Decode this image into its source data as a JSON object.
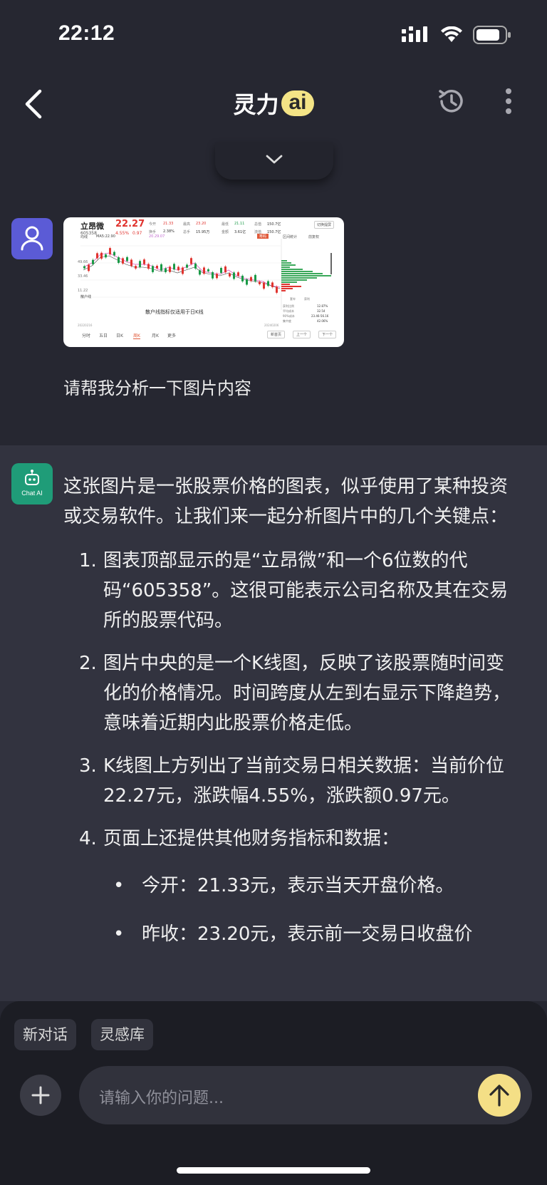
{
  "status_bar": {
    "time": "22:12"
  },
  "header": {
    "title": "灵力",
    "badge": "ai"
  },
  "user_message": {
    "text": "请帮我分析一下图片内容",
    "image": {
      "stock_name": "立昂微",
      "stock_code": "605358",
      "price": "22.27",
      "change_pct": "4.55%",
      "change_amt": "0.97",
      "quote_labels": [
        "今开",
        "换手",
        "最高",
        "总手",
        "最低",
        "金额",
        "总值",
        "流值"
      ],
      "quote_values": [
        "21.33",
        "2.38%",
        "23.20",
        "15.95万",
        "21.11",
        "3.61亿",
        "150.7亿",
        "150.7亿"
      ],
      "switch_btn": "切换提屏",
      "indicator": "均线",
      "ma_text": "MA5:22.90",
      "ma_text2": "20.29.07",
      "side_tabs": [
        "筹码",
        "区间统计",
        "前复权"
      ],
      "y_labels": [
        "",
        "49.66",
        "33.46",
        "11.22"
      ],
      "dots_label": "散户线",
      "notice": "散户线指标仅适用于日K线",
      "date_start": "20220216",
      "date_end": "20240206",
      "bottom_tabs": [
        "分时",
        "五日",
        "日K",
        "周K",
        "月K",
        "更多"
      ],
      "active_tab": "周K",
      "nav_buttons": [
        "新首页",
        "上一个",
        "下一个"
      ],
      "chip_stats_labels": [
        "获利比例",
        "平均成本",
        "90%成本",
        "集中度"
      ],
      "chip_stats_values": [
        "12.87%",
        "32.54",
        "23.46-56.16",
        "42.06%"
      ],
      "legend": [
        "套牢",
        "获利"
      ]
    }
  },
  "ai_message": {
    "avatar_label": "Chat AI",
    "intro": "这张图片是一张股票价格的图表，似乎使用了某种投资或交易软件。让我们来一起分析图片中的几个关键点：",
    "items": [
      {
        "num": "1.",
        "text": "图表顶部显示的是“立昂微”和一个6位数的代码“605358”。这很可能表示公司名称及其在交易所的股票代码。"
      },
      {
        "num": "2.",
        "text": "图片中央的是一个K线图，反映了该股票随时间变化的价格情况。时间跨度从左到右显示下降趋势，意味着近期内此股票价格走低。"
      },
      {
        "num": "3.",
        "text": "K线图上方列出了当前交易日相关数据：当前价位22.27元，涨跌幅4.55%，涨跌额0.97元。"
      },
      {
        "num": "4.",
        "text": "页面上还提供其他财务指标和数据："
      }
    ],
    "bullets": [
      {
        "dot": "•",
        "text": "今开：21.33元，表示当天开盘价格。"
      },
      {
        "dot": "•",
        "text": "昨收：23.20元，表示前一交易日收盘价"
      }
    ]
  },
  "bottom": {
    "chips": [
      "新对话",
      "灵感库"
    ],
    "input_placeholder": "请输入你的问题..."
  },
  "colors": {
    "background": "#262731",
    "ai_bg": "#32333f",
    "accent_yellow": "#f4df86",
    "user_avatar": "#5b5bd6",
    "ai_avatar": "#1f9c78"
  }
}
